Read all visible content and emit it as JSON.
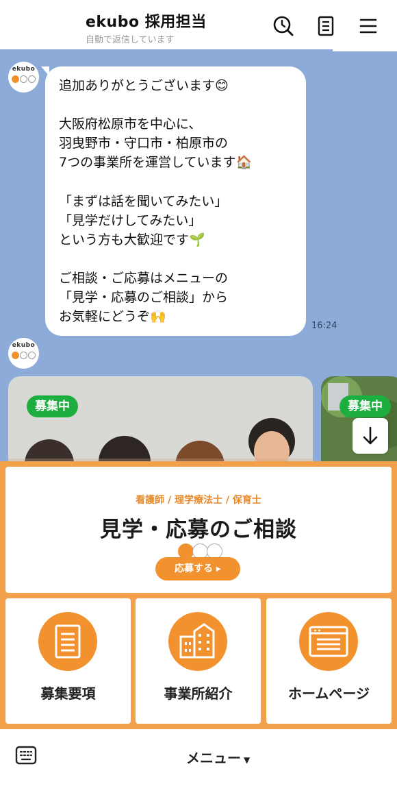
{
  "header": {
    "title": "ekubo 採用担当",
    "subtitle": "自動で返信しています",
    "icons": [
      "search-clock-icon",
      "notes-icon",
      "menu-icon"
    ]
  },
  "chat": {
    "avatar_text": "ekubo",
    "message": "追加ありがとうございます😊\n\n大阪府松原市を中心に、\n羽曳野市・守口市・柏原市の\n7つの事業所を運営しています🏠\n\n「まずは話を聞いてみたい」\n「見学だけしてみたい」\nという方も大歓迎です🌱\n\nご相談・ご応募はメニューの\n「見学・応募のご相談」から\nお気軽にどうぞ🙌",
    "time": "16:24",
    "cards": [
      {
        "badge": "募集中"
      },
      {
        "badge": "募集中"
      }
    ]
  },
  "rich_menu": {
    "big": {
      "subtitle": "看護師 / 理学療法士 / 保育士",
      "title": "見学・応募のご相談",
      "button": "応募する ▸"
    },
    "tiles": [
      {
        "label": "募集要項",
        "icon": "document-icon"
      },
      {
        "label": "事業所紹介",
        "icon": "building-icon"
      },
      {
        "label": "ホームページ",
        "icon": "browser-icon"
      }
    ],
    "colors": {
      "orange": "#F2922E",
      "frame": "#F2A04A",
      "green_badge": "#1EAE3F",
      "chat_bg": "#8CABD9"
    }
  },
  "bottom_bar": {
    "menu_label": "メニュー",
    "caret": "▼"
  }
}
